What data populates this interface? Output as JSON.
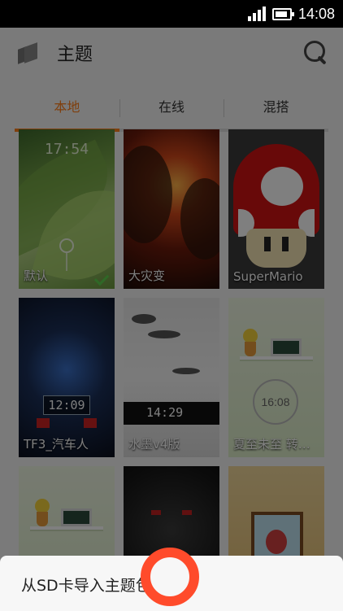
{
  "status_bar": {
    "time": "14:08",
    "battery_level": 0.85,
    "signal_bars": 4
  },
  "header": {
    "title": "主题",
    "search_icon": "search-icon",
    "back_icon": "folder-back-icon"
  },
  "tabs": [
    {
      "label": "本地",
      "active": true
    },
    {
      "label": "在线",
      "active": false
    },
    {
      "label": "混搭",
      "active": false
    }
  ],
  "themes": [
    {
      "name": "默认",
      "applied": true,
      "preview_time": "17:54"
    },
    {
      "name": "大灾变"
    },
    {
      "name": "SuperMario"
    },
    {
      "name": "TF3_汽车人",
      "preview_time": "12:09"
    },
    {
      "name": "水墨v4版",
      "preview_time": "14:29"
    },
    {
      "name": "夏至未至 转…",
      "preview_time": "16:08"
    },
    {
      "name": ""
    },
    {
      "name": ""
    },
    {
      "name": ""
    }
  ],
  "bottom_sheet": {
    "item_label": "从SD卡导入主题包"
  },
  "colors": {
    "accent": "#ff7f1a",
    "touch_indicator": "#ff4b2b",
    "applied_check": "#5fd24e"
  }
}
